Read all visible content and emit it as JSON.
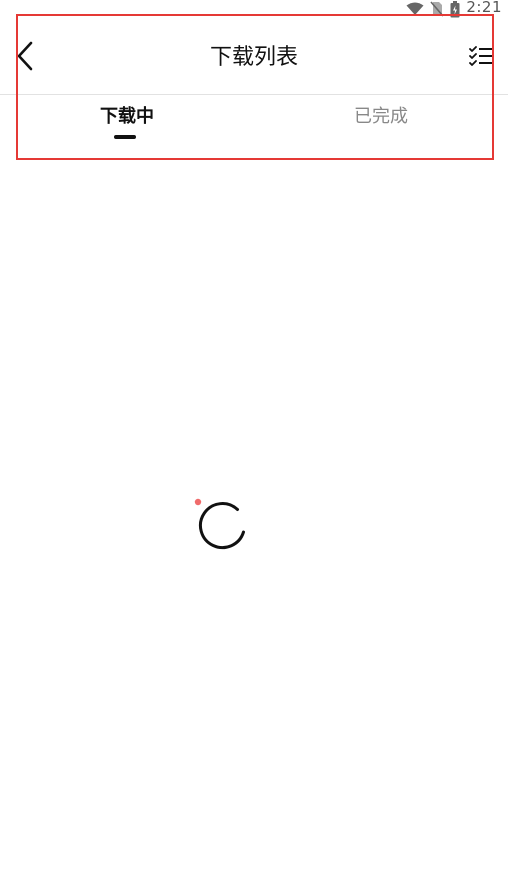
{
  "status_bar": {
    "time": "2:21",
    "icons": [
      "wifi-icon",
      "no-sim-icon",
      "battery-icon"
    ]
  },
  "header": {
    "title": "下载列表",
    "back_icon": "chevron-left-icon",
    "action_icon": "checklist-icon"
  },
  "tabs": [
    {
      "label": "下载中",
      "active": true
    },
    {
      "label": "已完成",
      "active": false
    }
  ],
  "loading": {
    "icon": "loading-spinner-icon",
    "accent_color": "#f06b6b"
  },
  "colors": {
    "highlight_border": "#e53935",
    "text_primary": "#111111",
    "text_secondary": "#888888"
  }
}
